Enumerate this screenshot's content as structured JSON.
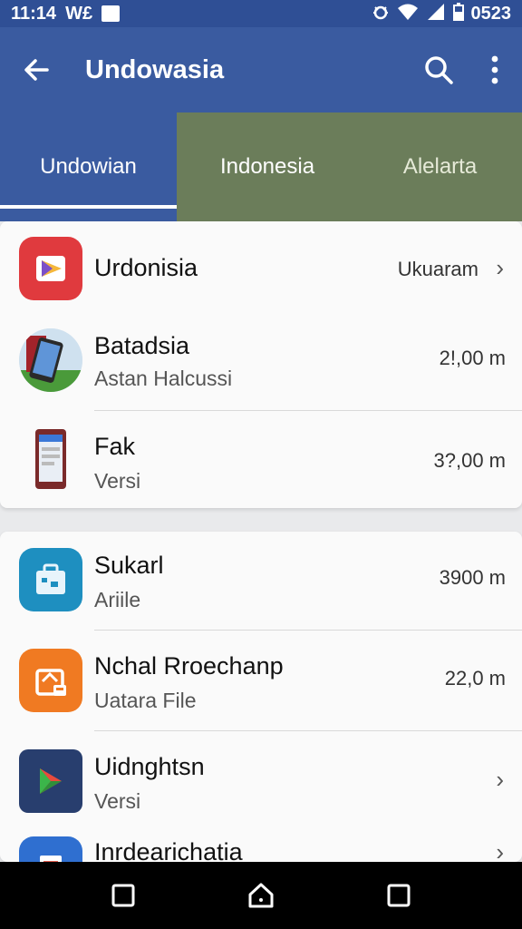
{
  "status_bar": {
    "time": "11:14",
    "carrier": "W£",
    "battery_text": "0523",
    "icons": [
      "notification-square-icon",
      "bug-icon",
      "wifi-icon",
      "signal-icon",
      "battery-icon"
    ]
  },
  "app_bar": {
    "title": "Undowasia",
    "icons": [
      "back-arrow-icon",
      "search-icon",
      "more-vert-icon"
    ]
  },
  "tabs": [
    {
      "label": "Undowian",
      "selected": true
    },
    {
      "label": "Indonesia",
      "selected": false
    },
    {
      "label": "Alelarta",
      "selected": false
    }
  ],
  "colors": {
    "status_bar": "#2f4f95",
    "app_bar": "#3a5ba0",
    "tab_selected": "#3a5ba0",
    "tab_unselected": "#6b7d5a",
    "navigation_bar": "#000000"
  },
  "list_groups": [
    {
      "items": [
        {
          "title": "Urdonisia",
          "subtitle": "",
          "value": "Ukuaram",
          "chevron": true,
          "icon": "red-play-icon"
        },
        {
          "title": "Batadsia",
          "subtitle": "Astan Halcussi",
          "value": "2!,00 m",
          "chevron": false,
          "icon": "phone-photo-icon"
        },
        {
          "title": "Fak",
          "subtitle": "Versi",
          "value": "3?,00 m",
          "chevron": false,
          "icon": "phone-screen-icon"
        }
      ]
    },
    {
      "items": [
        {
          "title": "Sukarl",
          "subtitle": "Ariile",
          "value": "3900 m",
          "chevron": false,
          "icon": "teal-briefcase-icon"
        },
        {
          "title": "Nchal Rroechanp",
          "subtitle": "Uatara File",
          "value": "22,0 m",
          "chevron": false,
          "icon": "orange-folder-icon"
        },
        {
          "title": "Uidnghtsn",
          "subtitle": "Versi",
          "value": "",
          "chevron": true,
          "icon": "navy-play-store-icon"
        },
        {
          "title": "Inrdearichatia",
          "subtitle": "",
          "value": "",
          "chevron": true,
          "icon": "blue-document-icon"
        }
      ]
    }
  ],
  "navigation_bar": {
    "icons": [
      "recents-square-icon",
      "home-icon",
      "back-square-icon"
    ]
  }
}
